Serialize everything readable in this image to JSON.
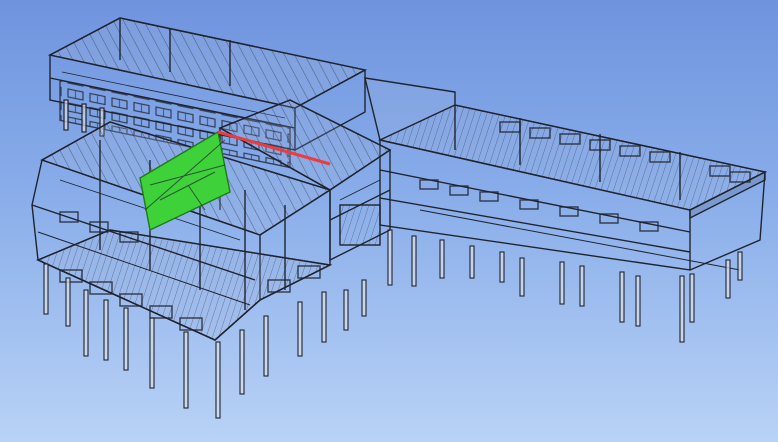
{
  "viewport": {
    "background_top": "#6f94de",
    "background_bottom": "#b9d2f6"
  },
  "model": {
    "wire_color": "#1f2430",
    "glass_tint": "#9eb5dd",
    "selected_face_color": "#3fd13a",
    "highlighted_edge_color": "#ef3b3b"
  }
}
